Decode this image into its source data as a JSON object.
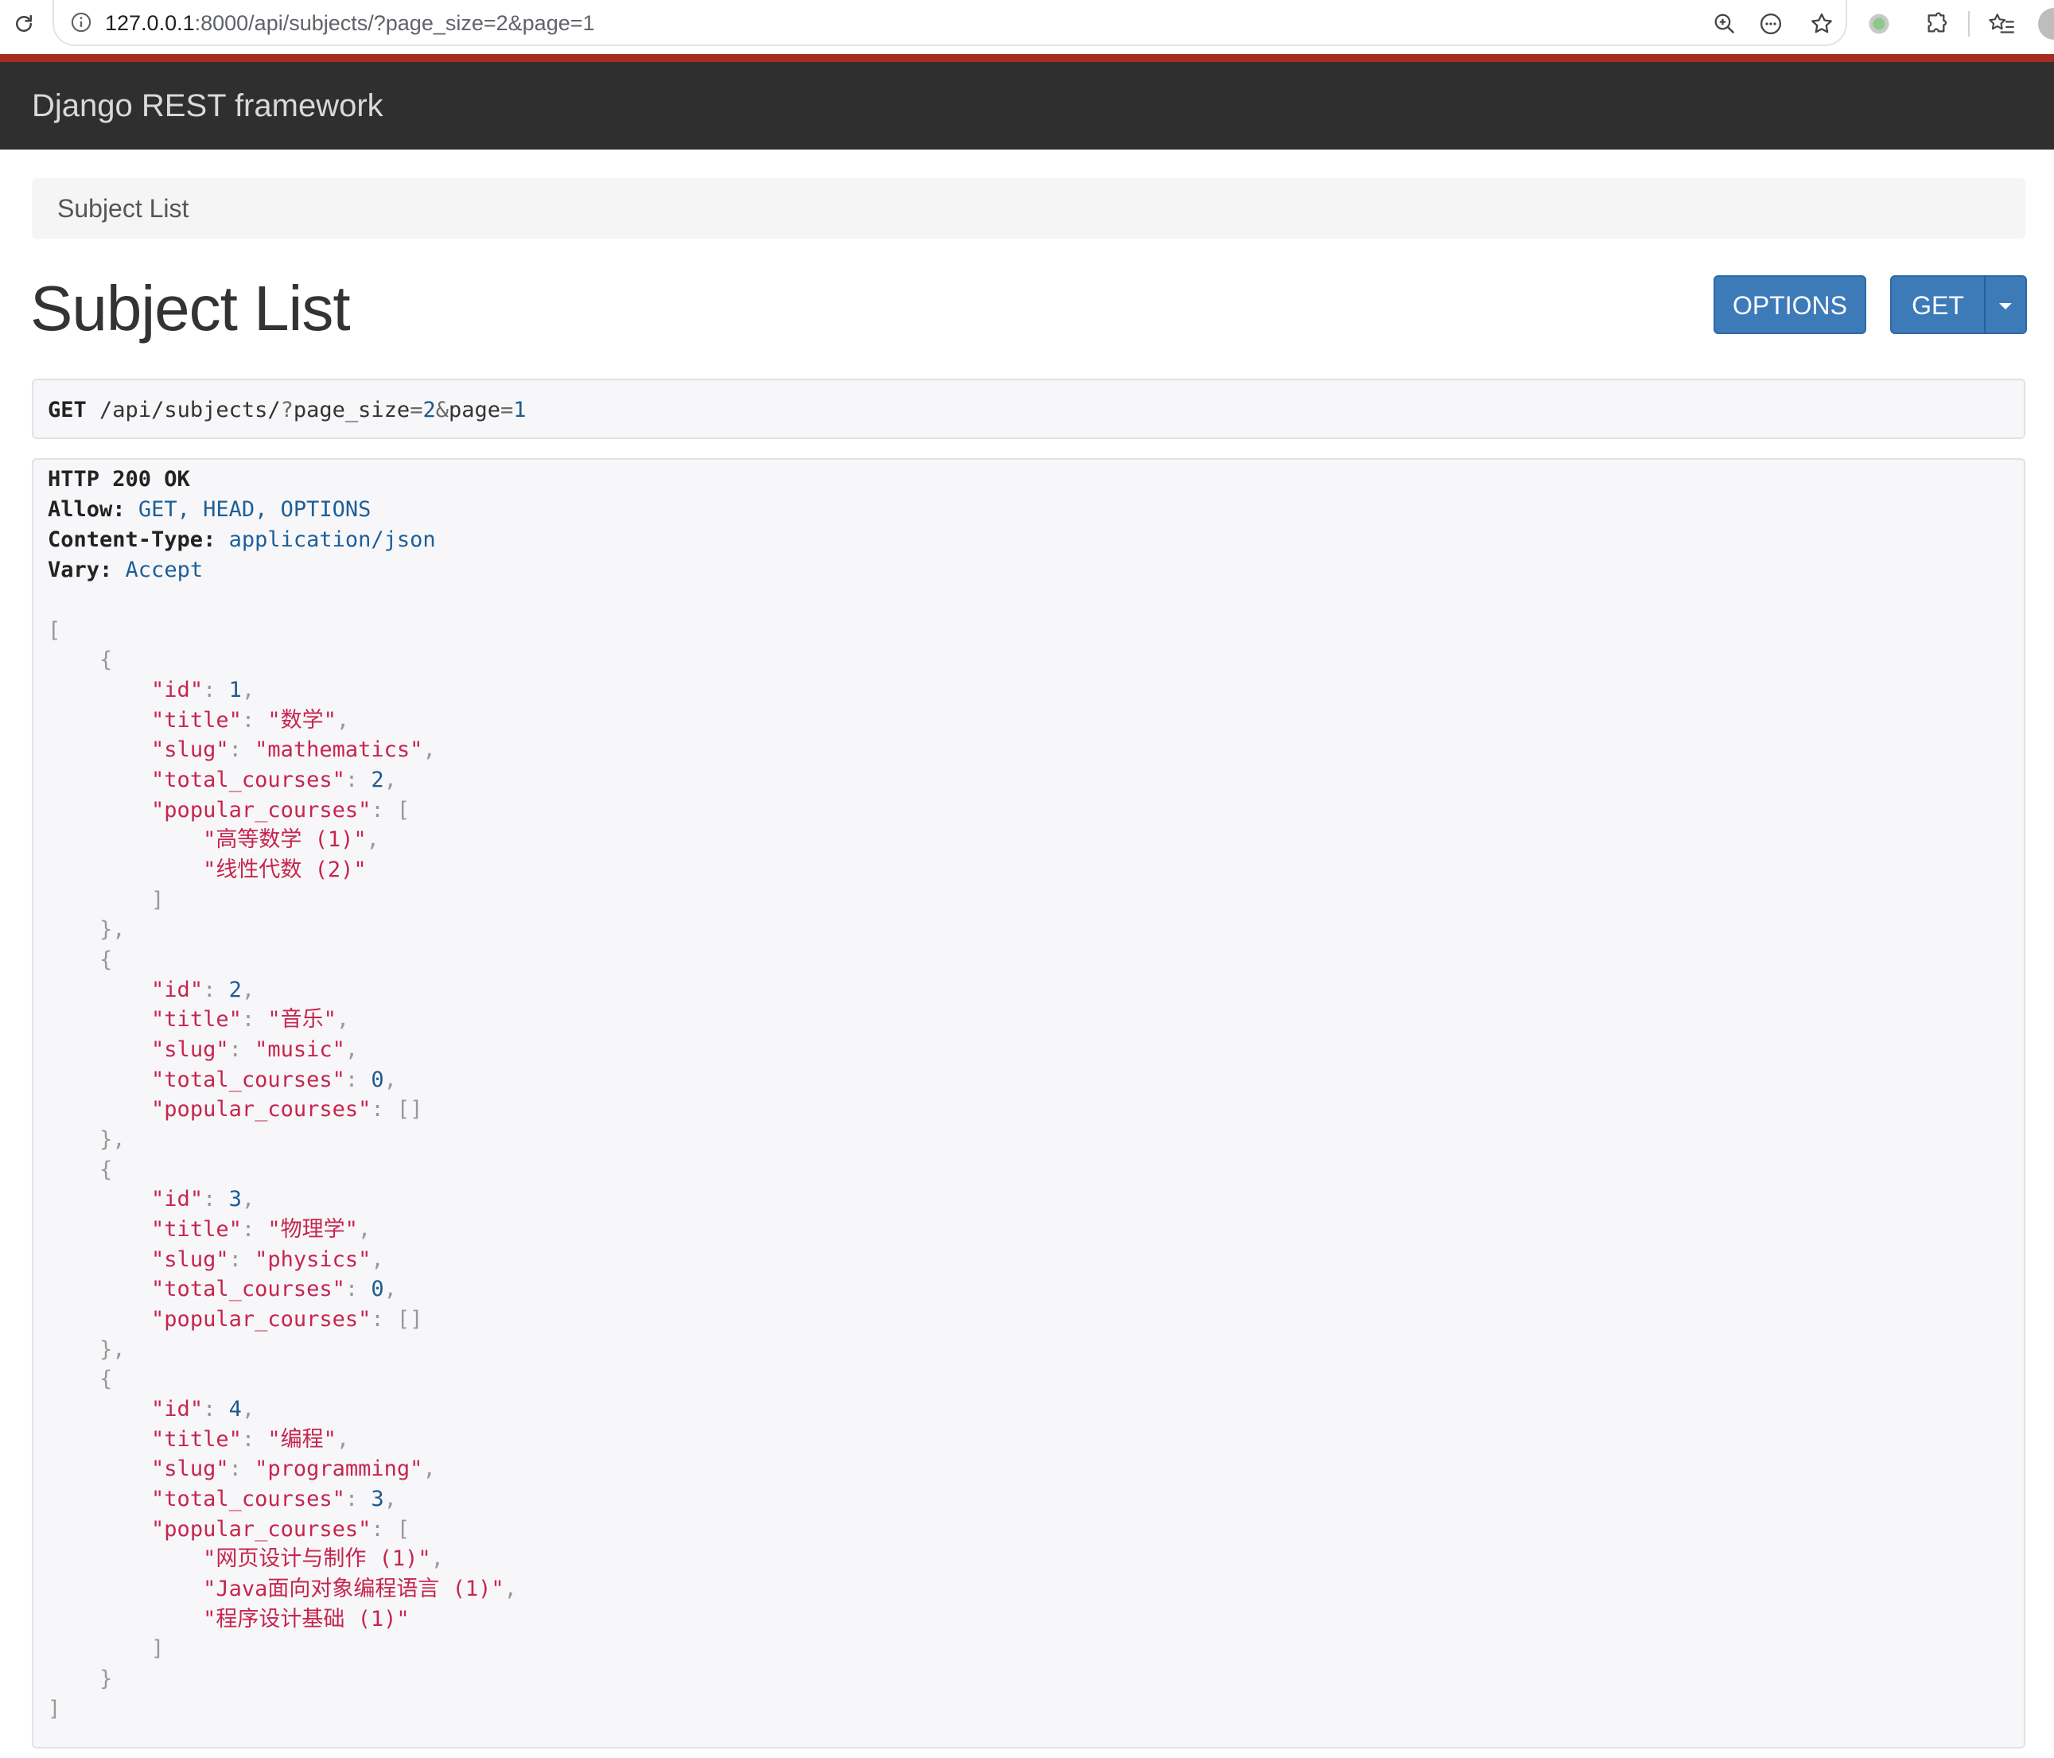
{
  "browser": {
    "url_host": "127.0.0.1",
    "url_rest": ":8000/api/subjects/?page_size=2&page=1"
  },
  "navbar": {
    "brand": "Django REST framework"
  },
  "breadcrumb": {
    "item": "Subject List"
  },
  "page": {
    "title": "Subject List"
  },
  "buttons": {
    "options": "OPTIONS",
    "get": "GET"
  },
  "request": {
    "method": "GET",
    "path": "/api/subjects/",
    "q": "?",
    "p1_key": "page_size",
    "p1_eq": "=",
    "p1_val": "2",
    "amp": "&",
    "p2_key": "page",
    "p2_eq": "=",
    "p2_val": "1"
  },
  "response": {
    "status": "HTTP 200 OK",
    "headers": [
      {
        "name": "Allow:",
        "value": "GET, HEAD, OPTIONS"
      },
      {
        "name": "Content-Type:",
        "value": "application/json"
      },
      {
        "name": "Vary:",
        "value": "Accept"
      }
    ],
    "keys": {
      "id": "\"id\"",
      "title": "\"title\"",
      "slug": "\"slug\"",
      "total_courses": "\"total_courses\"",
      "popular_courses": "\"popular_courses\""
    },
    "subjects": [
      {
        "id": "1",
        "title": "\"数学\"",
        "slug": "\"mathematics\"",
        "total_courses": "2",
        "popular_courses": [
          "\"高等数学 (1)\"",
          "\"线性代数 (2)\""
        ]
      },
      {
        "id": "2",
        "title": "\"音乐\"",
        "slug": "\"music\"",
        "total_courses": "0",
        "popular_courses": []
      },
      {
        "id": "3",
        "title": "\"物理学\"",
        "slug": "\"physics\"",
        "total_courses": "0",
        "popular_courses": []
      },
      {
        "id": "4",
        "title": "\"编程\"",
        "slug": "\"programming\"",
        "total_courses": "3",
        "popular_courses": [
          "\"网页设计与制作 (1)\"",
          "\"Java面向对象编程语言 (1)\"",
          "\"程序设计基础 (1)\""
        ]
      }
    ]
  }
}
